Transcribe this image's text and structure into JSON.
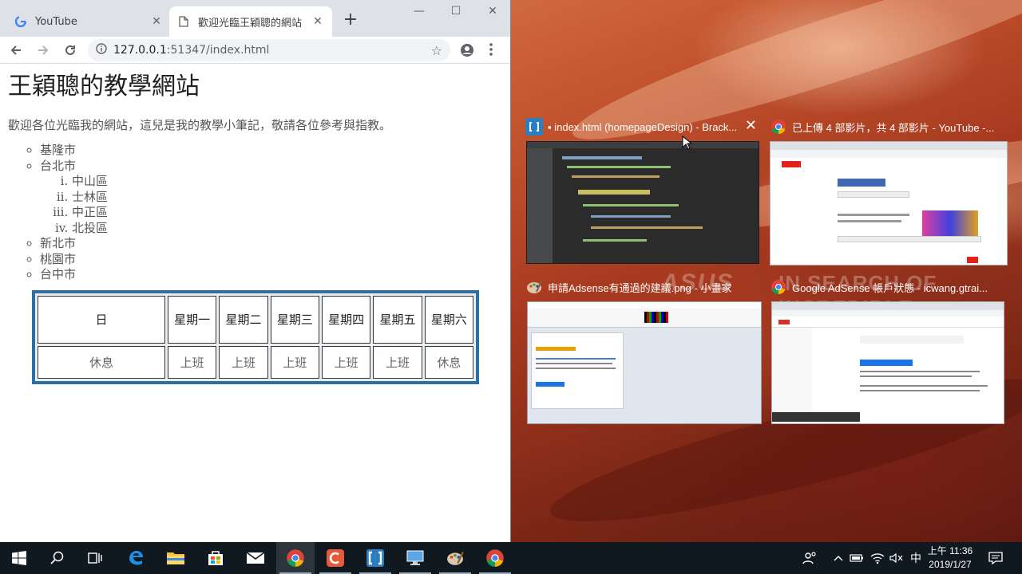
{
  "browser": {
    "tabs": [
      {
        "label": "YouTube",
        "active": false,
        "icon": "google-icon"
      },
      {
        "label": "歡迎光臨王穎聰的網站",
        "active": true,
        "icon": "document-icon"
      }
    ],
    "url_host": "127.0.0.1",
    "url_rest": ":51347/index.html"
  },
  "page": {
    "heading": "王穎聰的教學網站",
    "intro": "歡迎各位光臨我的網站，這兒是我的教學小筆記，敬請各位參考與指教。",
    "cities": [
      "基隆市",
      "台北市",
      "新北市",
      "桃園市",
      "台中市"
    ],
    "districts": [
      "中山區",
      "士林區",
      "中正區",
      "北投區"
    ],
    "table": {
      "headers": [
        "日",
        "星期一",
        "星期二",
        "星期三",
        "星期四",
        "星期五",
        "星期六"
      ],
      "row": [
        "休息",
        "上班",
        "上班",
        "上班",
        "上班",
        "上班",
        "休息"
      ]
    }
  },
  "task_view": [
    {
      "title": "▪ index.html (homepageDesign) - Brack...",
      "app": "brackets"
    },
    {
      "title": "已上傳 4 部影片，共 4 部影片 - YouTube -...",
      "app": "chrome"
    },
    {
      "title": "申請Adsense有通過的建議.png - 小畫家",
      "app": "paint"
    },
    {
      "title": "Google AdSense 帳戶狀態 - icwang.gtrai...",
      "app": "chrome"
    }
  ],
  "wallpaper": {
    "brand": "ASUS",
    "tagline": "IN SEARCH OF INCREDIBLE"
  },
  "taskbar": {
    "ime": "中",
    "time": "上午 11:36",
    "date": "2019/1/27"
  },
  "colors": {
    "accent": "#2f6f9f",
    "taskbar": "#101820"
  }
}
